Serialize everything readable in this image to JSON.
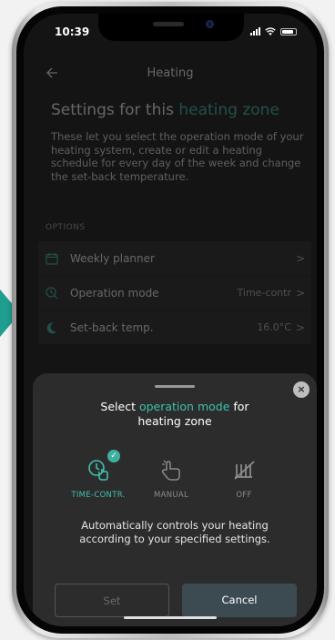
{
  "status_bar": {
    "time": "10:39"
  },
  "nav": {
    "title": "Heating"
  },
  "page": {
    "title_prefix": "Settings for this ",
    "title_highlight": "heating zone",
    "intro": "These let you select the operation mode of your heating system, create or edit a heating schedule for every day of the week and change the set-back temperature."
  },
  "options": {
    "heading": "OPTIONS",
    "items": [
      {
        "label": "Weekly planner",
        "value": "",
        "icon": "calendar-icon"
      },
      {
        "label": "Operation mode",
        "value": "Time-contr",
        "icon": "clock-hand-icon"
      },
      {
        "label": "Set-back temp.",
        "value": "16.0°C",
        "icon": "moon-icon"
      }
    ],
    "chevron": ">"
  },
  "sheet": {
    "title_prefix": "Select ",
    "title_highlight": "operation mode",
    "title_suffix": " for",
    "title_line2": "heating zone",
    "close_symbol": "×",
    "check_symbol": "✓",
    "modes": [
      {
        "label": "TIME-CONTR.",
        "icon": "clock-touch-icon",
        "selected": true
      },
      {
        "label": "MANUAL",
        "icon": "hand-tap-icon",
        "selected": false
      },
      {
        "label": "OFF",
        "icon": "heating-off-icon",
        "selected": false
      }
    ],
    "description_line1": "Automatically controls your heating",
    "description_line2": "according to your specified settings.",
    "set_label": "Set",
    "cancel_label": "Cancel"
  },
  "colors": {
    "accent": "#3fc0b0",
    "pointer": "#1f9e8f",
    "cancel_button": "#3b4b51"
  }
}
